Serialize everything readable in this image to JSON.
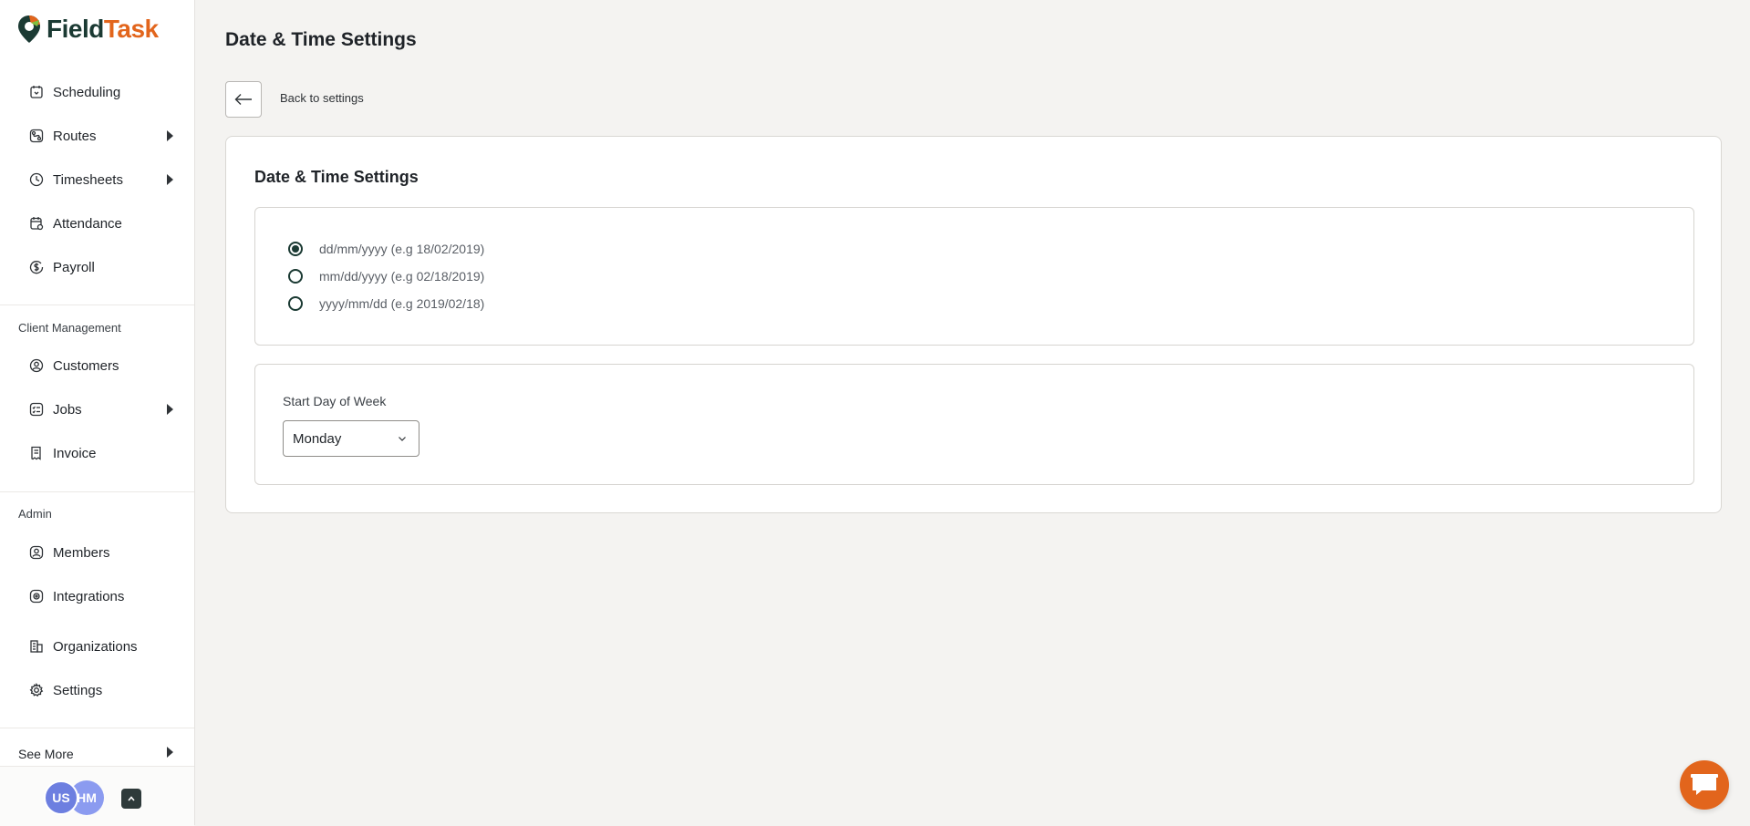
{
  "app": {
    "logo_part1": "Field",
    "logo_part2": "Task",
    "colors": {
      "brand_dark": "#1b3a33",
      "brand_orange": "#e2651c",
      "avatar_blue": "#6d7fe0"
    }
  },
  "sidebar": {
    "items": [
      {
        "label": "Scheduling",
        "icon": "calendar-clock-icon"
      },
      {
        "label": "Routes",
        "icon": "route-icon",
        "has_submenu": true
      },
      {
        "label": "Timesheets",
        "icon": "clock-icon",
        "has_submenu": true
      },
      {
        "label": "Attendance",
        "icon": "attendance-calendar-icon"
      },
      {
        "label": "Payroll",
        "icon": "dollar-coin-icon"
      }
    ],
    "client_section": "Client Management",
    "client_items": [
      {
        "label": "Customers",
        "icon": "user-circle-icon"
      },
      {
        "label": "Jobs",
        "icon": "checklist-icon",
        "has_submenu": true
      },
      {
        "label": "Invoice",
        "icon": "receipt-icon"
      }
    ],
    "admin_section": "Admin",
    "admin_items": [
      {
        "label": "Members",
        "icon": "member-icon"
      },
      {
        "label": "Integrations",
        "icon": "integration-icon"
      },
      {
        "label": "Organizations",
        "icon": "building-icon"
      },
      {
        "label": "Settings",
        "icon": "gear-icon"
      }
    ],
    "see_more": "See More",
    "avatars": [
      "US",
      "HM"
    ]
  },
  "main": {
    "page_title": "Date & Time Settings",
    "back_label": "Back to settings",
    "card_title": "Date & Time Settings",
    "date_formats": [
      {
        "label": "dd/mm/yyyy (e.g 18/02/2019)",
        "selected": true
      },
      {
        "label": "mm/dd/yyyy (e.g 02/18/2019)",
        "selected": false
      },
      {
        "label": "yyyy/mm/dd (e.g 2019/02/18)",
        "selected": false
      }
    ],
    "start_day_label": "Start Day of Week",
    "start_day_value": "Monday"
  }
}
